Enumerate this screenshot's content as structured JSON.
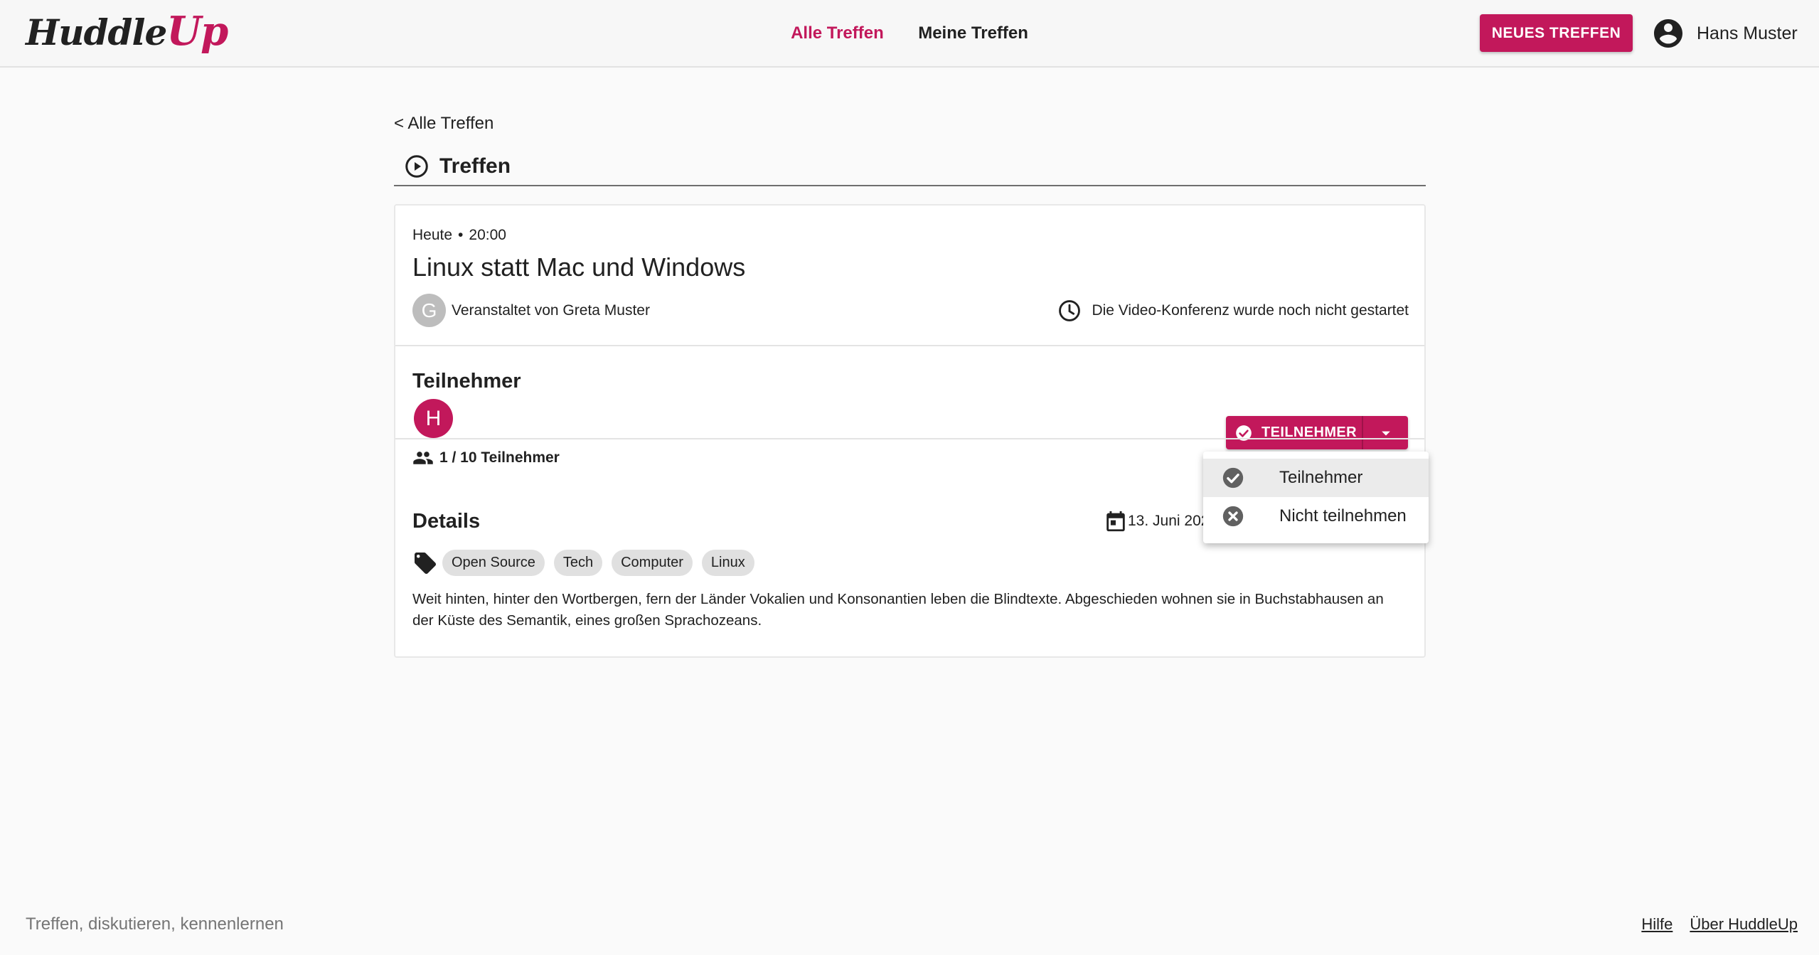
{
  "header": {
    "logo_main": "Huddle",
    "logo_accent": "Up",
    "nav": [
      {
        "label": "Alle Treffen",
        "active": true
      },
      {
        "label": "Meine Treffen",
        "active": false
      }
    ],
    "new_button": "NEUES TREFFEN",
    "user_name": "Hans Muster"
  },
  "breadcrumb": {
    "back_label": "< Alle Treffen"
  },
  "section": {
    "title": "Treffen",
    "icon": "play-circle-icon"
  },
  "meeting": {
    "day": "Heute",
    "separator": "•",
    "time": "20:00",
    "title": "Linux statt Mac und Windows",
    "organizer_initial": "G",
    "organizer_text": "Veranstaltet von Greta Muster",
    "video_status": "Die Video-Konferenz wurde noch nicht gestartet"
  },
  "participants": {
    "title": "Teilnehmer",
    "avatar_initial": "H",
    "count_text": "1 / 10 Teilnehmer",
    "button_label": "TEILNEHMER",
    "menu": [
      {
        "label": "Teilnehmer",
        "icon": "check-circle-icon",
        "selected": true
      },
      {
        "label": "Nicht teilnehmen",
        "icon": "cancel-circle-icon",
        "selected": false
      }
    ]
  },
  "details": {
    "title": "Details",
    "date": "13. Juni 2020",
    "tags": [
      "Open Source",
      "Tech",
      "Computer",
      "Linux"
    ],
    "description": "Weit hinten, hinter den Wortbergen, fern der Länder Vokalien und Konsonantien leben die Blindtexte. Abgeschieden wohnen sie in Buchstabhausen an der Küste des Semantik, eines großen Sprachozeans."
  },
  "footer": {
    "tagline": "Treffen, diskutieren, kennenlernen",
    "links": [
      "Hilfe",
      "Über HuddleUp"
    ]
  },
  "colors": {
    "accent": "#c2185b",
    "background": "#fafafa"
  }
}
